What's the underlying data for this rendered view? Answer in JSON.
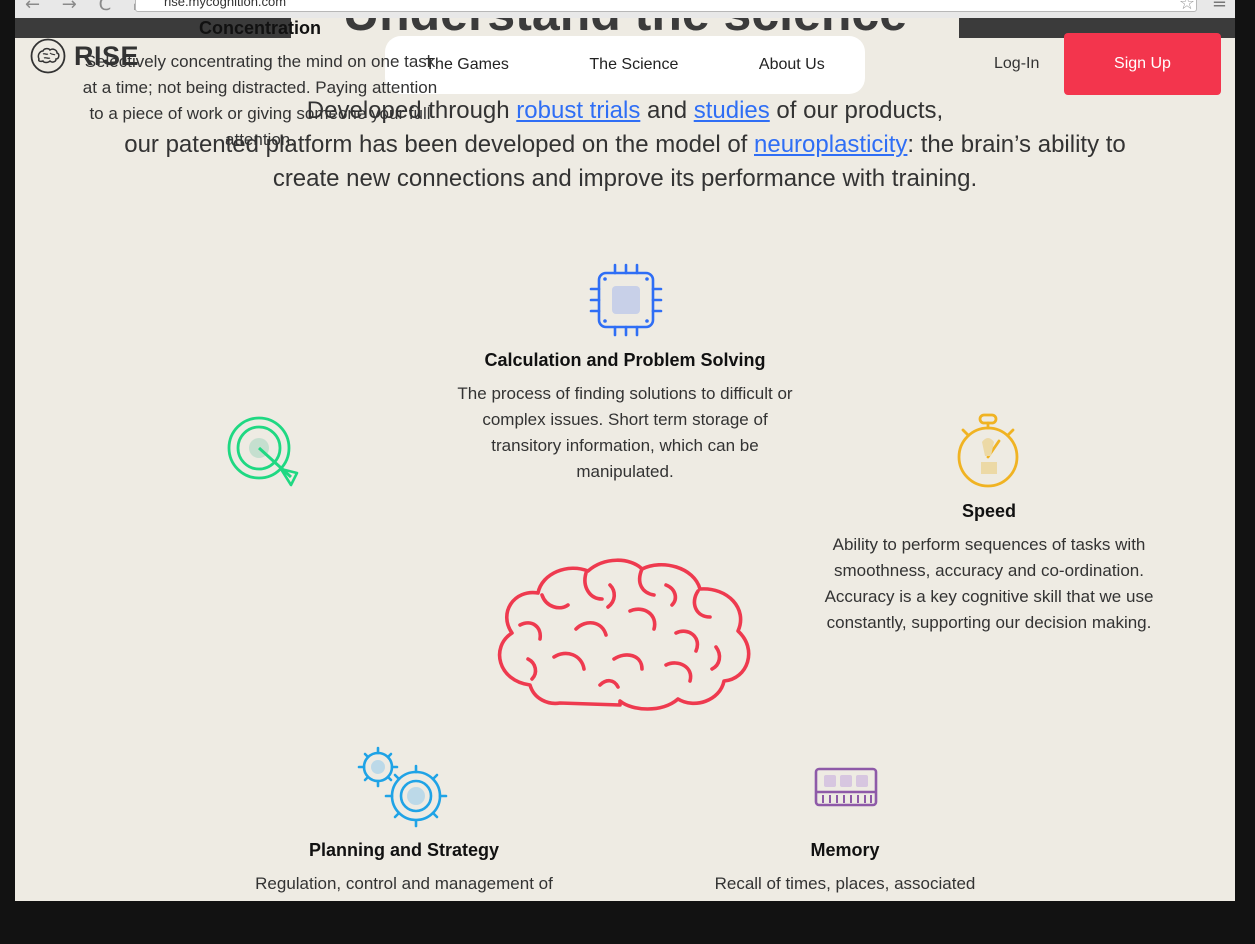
{
  "browser": {
    "url": "rise.mycognition.com",
    "nav_glyphs": "← → C ⌂",
    "star_glyph": "☆",
    "menu_glyph": "≡"
  },
  "hero": {
    "heading": "Understand the science"
  },
  "header": {
    "brand": "RISE",
    "nav": [
      "The Games",
      "The Science",
      "About Us"
    ],
    "login": "Log-In",
    "signup": "Sign Up",
    "signup_color": "#f3354d"
  },
  "intro": {
    "l1_a": "Developed through ",
    "link1": "robust trials",
    "l1_b": " and ",
    "link2": "studies",
    "l1_c": " of our products,",
    "l2_a": "our patented platform has been developed on the model of ",
    "link3": "neuroplasticity",
    "l2_b": ": the brain’s ability to",
    "l3": "create new connections and improve its performance with training."
  },
  "features": {
    "calculation": {
      "title": "Calculation and Problem Solving",
      "desc": "The process of finding solutions to difficult or complex issues. Short term storage of transitory information, which can be manipulated.",
      "icon": "chip-icon",
      "color": "#2f6ef5"
    },
    "concentration": {
      "title": "Concentration",
      "desc": "Selectively concentrating the mind on one task at a time; not being distracted. Paying attention to a piece of work or giving someone your full attention.",
      "icon": "target-icon",
      "color": "#1fd882"
    },
    "speed": {
      "title": "Speed",
      "desc": "Ability to perform sequences of tasks with smoothness, accuracy and co-ordination. Accuracy is a key cognitive skill that we use constantly, supporting our decision making.",
      "icon": "stopwatch-icon",
      "color": "#f0b323"
    },
    "planning": {
      "title": "Planning and Strategy",
      "desc": "Regulation, control and management of",
      "icon": "gears-icon",
      "color": "#1fa3e6"
    },
    "memory": {
      "title": "Memory",
      "desc": "Recall of times, places, associated",
      "icon": "memory-chip-icon",
      "color": "#8e5aa8"
    }
  },
  "center_icon": {
    "name": "brain-icon",
    "color": "#ee3a4f"
  }
}
